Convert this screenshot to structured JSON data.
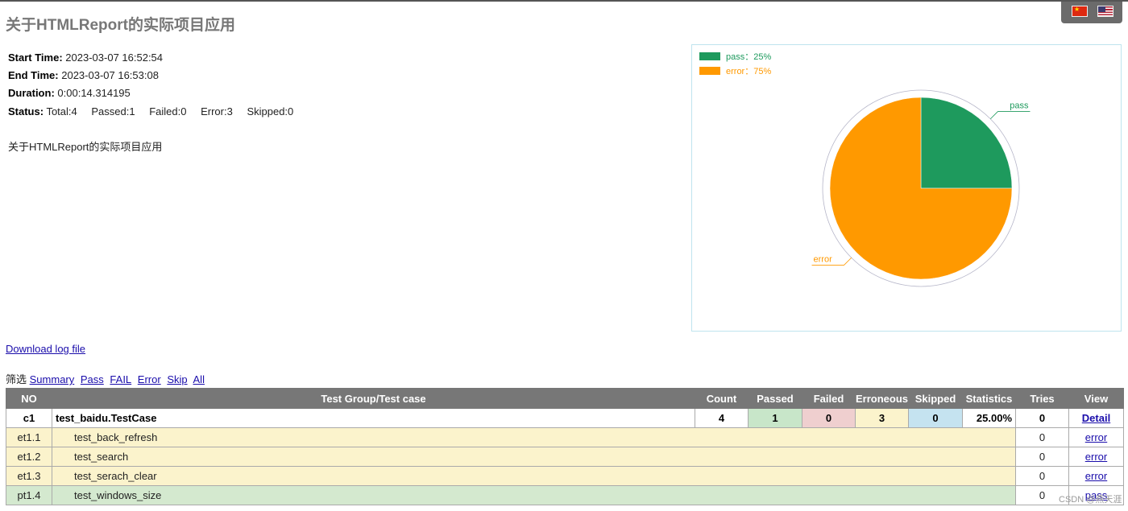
{
  "header": {
    "title": "关于HTMLReport的实际项目应用",
    "languages": [
      {
        "name": "Chinese",
        "icon": "cn-flag-icon"
      },
      {
        "name": "English",
        "icon": "us-flag-icon"
      }
    ]
  },
  "summary": {
    "start_time_label": "Start Time:",
    "start_time": "2023-03-07 16:52:54",
    "end_time_label": "End Time:",
    "end_time": "2023-03-07 16:53:08",
    "duration_label": "Duration:",
    "duration": "0:00:14.314195",
    "status_label": "Status:",
    "status_total": "Total:4",
    "status_passed": "Passed:1",
    "status_failed": "Failed:0",
    "status_error": "Error:3",
    "status_skipped": "Skipped:0",
    "description": "关于HTMLReport的实际项目应用"
  },
  "chart_data": {
    "type": "pie",
    "categories": [
      "pass",
      "error"
    ],
    "values": [
      25,
      75
    ],
    "legend": [
      "pass：25%",
      "error：75%"
    ],
    "slice_labels": [
      "pass",
      "error"
    ],
    "colors": [
      "#1e9a5d",
      "#ff9900"
    ],
    "legend_position": "top-left"
  },
  "links": {
    "download_log": "Download log file"
  },
  "filter": {
    "label": "筛选",
    "options": [
      "Summary",
      "Pass",
      "FAIL",
      "Error",
      "Skip",
      "All"
    ]
  },
  "table": {
    "headers": {
      "no": "NO",
      "group": "Test Group/Test case",
      "count": "Count",
      "passed": "Passed",
      "failed": "Failed",
      "erroneous": "Erroneous",
      "skipped": "Skipped",
      "statistics": "Statistics",
      "tries": "Tries",
      "view": "View"
    },
    "group": {
      "no": "c1",
      "name": "test_baidu.TestCase",
      "count": "4",
      "passed": "1",
      "failed": "0",
      "erroneous": "3",
      "skipped": "0",
      "statistics": "25.00%",
      "tries": "0",
      "view": "Detail"
    },
    "cases": [
      {
        "no": "et1.1",
        "name": "test_back_refresh",
        "tries": "0",
        "view": "error",
        "status": "error"
      },
      {
        "no": "et1.2",
        "name": "test_search",
        "tries": "0",
        "view": "error",
        "status": "error"
      },
      {
        "no": "et1.3",
        "name": "test_serach_clear",
        "tries": "0",
        "view": "error",
        "status": "error"
      },
      {
        "no": "pt1.4",
        "name": "test_windows_size",
        "tries": "0",
        "view": "pass",
        "status": "pass"
      }
    ]
  },
  "watermark": "CSDN @燕天涯"
}
